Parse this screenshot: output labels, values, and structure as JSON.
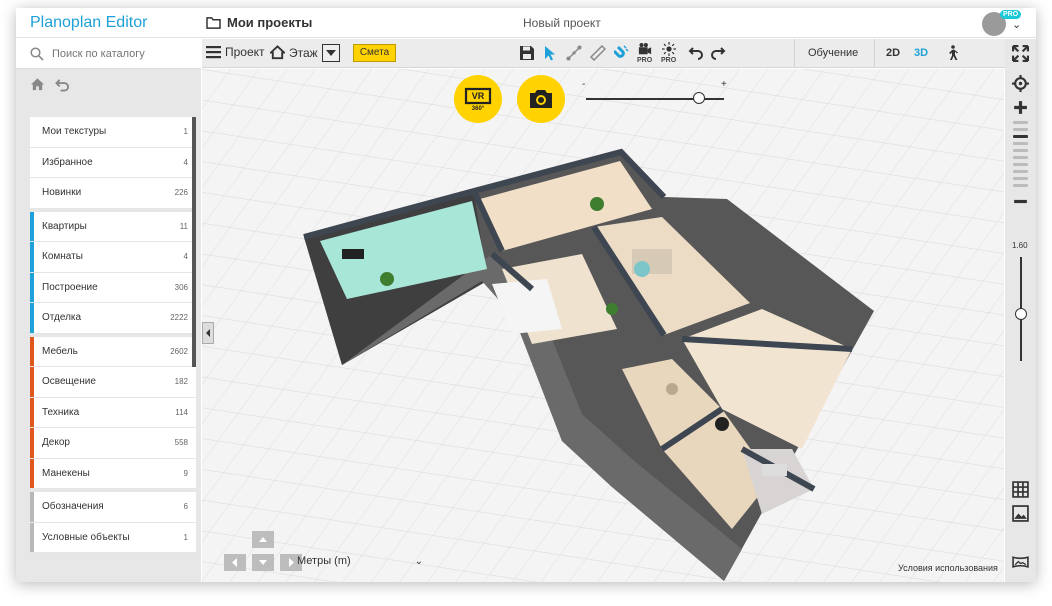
{
  "topbar": {
    "logo": "Planoplan Editor",
    "projects_label": "Мои проекты",
    "project_name": "Новый проект",
    "pro_badge": "PRO"
  },
  "search": {
    "placeholder": "Поиск по каталогу"
  },
  "catalog": {
    "groups": [
      {
        "color": "",
        "items": [
          {
            "label": "Мои текстуры",
            "count": "1"
          },
          {
            "label": "Избранное",
            "count": "4"
          },
          {
            "label": "Новинки",
            "count": "226"
          }
        ]
      },
      {
        "color": "#1ea0d8",
        "items": [
          {
            "label": "Квартиры",
            "count": "11"
          },
          {
            "label": "Комнаты",
            "count": "4"
          },
          {
            "label": "Построение",
            "count": "306"
          },
          {
            "label": "Отделка",
            "count": "2222"
          }
        ]
      },
      {
        "color": "#e0571e",
        "items": [
          {
            "label": "Мебель",
            "count": "2602"
          },
          {
            "label": "Освещение",
            "count": "182"
          },
          {
            "label": "Техника",
            "count": "114"
          },
          {
            "label": "Декор",
            "count": "558"
          },
          {
            "label": "Манекены",
            "count": "9"
          }
        ]
      },
      {
        "color": "#b9b9b9",
        "items": [
          {
            "label": "Обозначения",
            "count": "6"
          },
          {
            "label": "Условные объекты",
            "count": "1"
          }
        ]
      }
    ]
  },
  "toolbar": {
    "project_label": "Проект",
    "floor_label": "Этаж",
    "estimate_label": "Смета",
    "pro_label": "PRO",
    "learn_label": "Обучение",
    "view_2d": "2D",
    "view_3d": "3D",
    "accent": "#1ea0d8"
  },
  "canvas": {
    "vr_label": "VR",
    "vr_sub": "360°",
    "slider_min": "-",
    "slider_max": "+",
    "slider_value": 0.82,
    "units_label": "Метры (m)",
    "terms_label": "Условия использования"
  },
  "rightpanel": {
    "height_label": "1.60",
    "height_value": 0.55
  },
  "icons": [
    "search-icon",
    "home-icon",
    "undo-icon",
    "menu-icon",
    "house-icon",
    "save-icon",
    "cursor-icon",
    "wall-icon",
    "ruler-icon",
    "magnet-icon",
    "video-icon",
    "light-icon",
    "undo-arrow-icon",
    "redo-arrow-icon",
    "walk-icon",
    "fullscreen-icon",
    "locate-icon",
    "zoom-in-icon",
    "zoom-out-icon",
    "grid-icon",
    "image-icon",
    "panorama-icon",
    "camera-icon",
    "vr-icon",
    "folder-icon"
  ]
}
